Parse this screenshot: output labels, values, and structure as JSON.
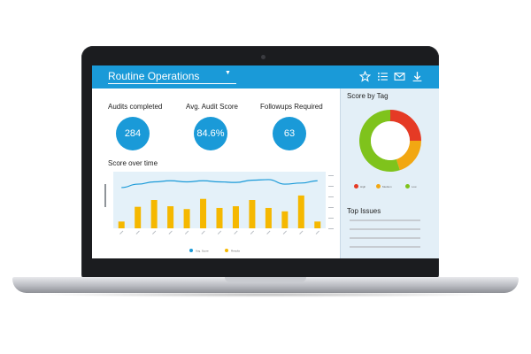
{
  "header": {
    "title": "Routine Operations",
    "caret": "▼",
    "icons": [
      "star-icon",
      "list-icon",
      "mail-icon",
      "download-icon"
    ]
  },
  "kpis": [
    {
      "label": "Audits completed",
      "value": "284"
    },
    {
      "label": "Avg. Audit Score",
      "value": "84.6%"
    },
    {
      "label": "Followups Required",
      "value": "63"
    }
  ],
  "score_over_time": {
    "title": "Score over time"
  },
  "score_by_tag": {
    "title": "Score by Tag",
    "legend": [
      {
        "label": "High",
        "color": "#e53a25"
      },
      {
        "label": "Medium",
        "color": "#f2a712"
      },
      {
        "label": "Low",
        "color": "#7fc31c"
      }
    ]
  },
  "top_issues": {
    "title": "Top Issues"
  },
  "colors": {
    "accent": "#1a9ad8",
    "bar": "#f5b800",
    "line": "#1a9ad8"
  },
  "chart_data": [
    {
      "type": "bar",
      "title": "Score over time",
      "categories": [
        "1",
        "2",
        "3",
        "4",
        "5",
        "6",
        "7",
        "8",
        "9",
        "10",
        "11",
        "12",
        "13"
      ],
      "series": [
        {
          "name": "Results",
          "type": "bar",
          "values": [
            12,
            38,
            50,
            39,
            34,
            52,
            36,
            39,
            50,
            36,
            30,
            58,
            12
          ]
        },
        {
          "name": "Avg. Score",
          "type": "line",
          "values": [
            72,
            78,
            82,
            84,
            82,
            84,
            82,
            81,
            85,
            86,
            78,
            80,
            84
          ]
        }
      ],
      "ylim": [
        0,
        100
      ]
    },
    {
      "type": "pie",
      "title": "Score by Tag",
      "categories": [
        "High",
        "Medium",
        "Low"
      ],
      "values": [
        25,
        20,
        55
      ]
    }
  ]
}
